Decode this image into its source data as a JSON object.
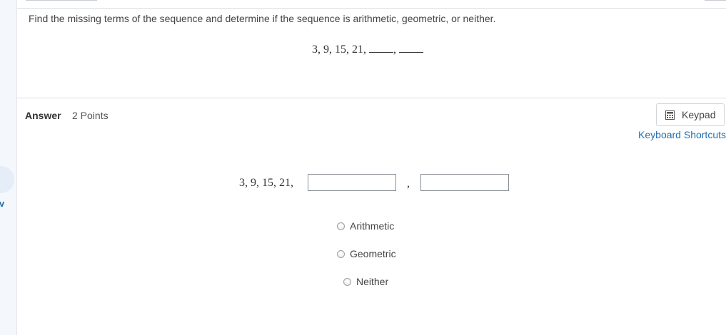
{
  "rail": {
    "glyph": "v"
  },
  "question": {
    "prompt": "Find the missing terms of the sequence and determine if the sequence is arithmetic, geometric, or neither.",
    "sequence": "3, 9, 15, 21,",
    "separator": ","
  },
  "answer": {
    "label": "Answer",
    "points": "2 Points",
    "sequence": "3, 9, 15, 21,",
    "separator": ",",
    "inputs": [
      {
        "value": ""
      },
      {
        "value": ""
      }
    ],
    "options": [
      {
        "label": "Arithmetic",
        "selected": false
      },
      {
        "label": "Geometric",
        "selected": false
      },
      {
        "label": "Neither",
        "selected": false
      }
    ]
  },
  "tools": {
    "keypad_label": "Keypad",
    "keypad_icon": "calculator-icon",
    "shortcuts_label": "Keyboard Shortcuts"
  },
  "colors": {
    "link": "#1f6fb2",
    "divider": "#dcdfe3"
  }
}
